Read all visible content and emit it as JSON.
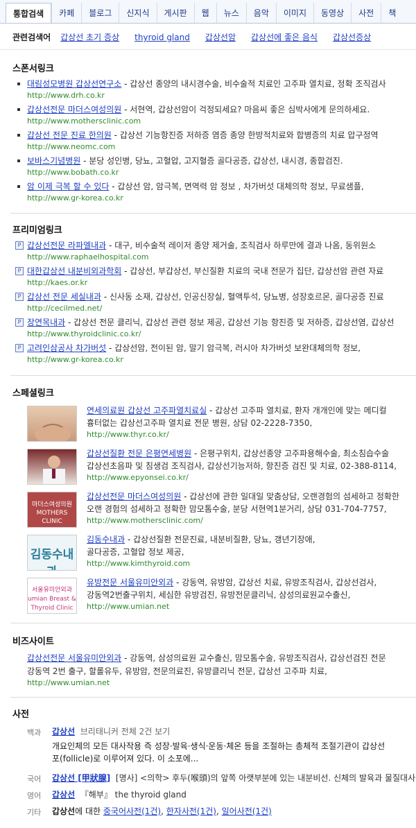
{
  "tabs": [
    "통합검색",
    "카페",
    "블로그",
    "신지식",
    "게시판",
    "웹",
    "뉴스",
    "음악",
    "이미지",
    "동영상",
    "사전",
    "책"
  ],
  "related": {
    "label": "관련검색어",
    "items": [
      "갑상선 초기 증상",
      "thyroid gland",
      "갑상선암",
      "갑상선에 좋은 음식",
      "갑상선증상"
    ]
  },
  "sponsor": {
    "title": "스폰서링크",
    "items": [
      {
        "title": "대림성모병원 갑상선연구소",
        "desc": "갑상선 종양의 내시경수술, 비수술적 치료인 고주파 열치료, 정확 조직검사",
        "url": "http://www.drh.co.kr"
      },
      {
        "title": "갑상선전문 마더스여성의원",
        "desc": "서현역, 갑상선암이 걱정되세요? 마음씨 좋은 심박사에게 문의하세요.",
        "url": "http://www.mothersclinic.com"
      },
      {
        "title": "갑상선 전문 진료 한의원",
        "desc": "갑상선 기능항진증 저하증 염증 종양 한방적치료와 합병증의 치료 압구정역",
        "url": "http://www.neomc.com"
      },
      {
        "title": "보바스기념병원",
        "desc": "분당 성인병, 당뇨, 고혈압, 고지혈증 골다공증, 갑상선, 내시경, 종합검진.",
        "url": "http://www.bobath.co.kr"
      },
      {
        "title": "암 이제 극복 할 수 있다",
        "desc": "갑상선 암, 암극복, 면역력 암 정보 , 차가버섯 대체의학 정보, 무료샘플,",
        "url": "http://www.gr-korea.co.kr"
      }
    ]
  },
  "premium": {
    "title": "프리미엄링크",
    "items": [
      {
        "title": "갑상선전문 라파엘내과",
        "desc": "대구, 비수술적 레이저 종양 제거술, 조직검사 하루만에 결과 나옴, 동위원소",
        "url": "http://www.raphaelhospital.com"
      },
      {
        "title": "대한갑상선 내분비외과학회",
        "desc": "갑상선, 부갑상선, 부신질환 치료의 국내 전문가 집단, 갑상선암 관련 자료",
        "url": "http://kaes.or.kr"
      },
      {
        "title": "갑상선 전문 세실내과",
        "desc": "신사동 소재, 갑상선, 인공신장실, 혈액투석, 당뇨병, 성장호르몬, 골다공증 진료",
        "url": "http://cecilmed.net/"
      },
      {
        "title": "장연목내과",
        "desc": "갑상선 전문 클리닉, 갑상선 관련 정보 제공, 갑상선 기능 항진증 및 저하증, 갑상선염, 갑상선",
        "url": "http://www.thyroidclinic.co.kr/"
      },
      {
        "title": "고려인삼공사 차가버섯",
        "desc": "갑상선암, 전이된 암, 말기 암극복, 러시아 차가버섯 보완대체의학 정보,",
        "url": "http://www.gr-korea.co.kr"
      }
    ]
  },
  "special": {
    "title": "스페셜링크",
    "items": [
      {
        "title": "연세의료원 갑상선 고주파열치료실",
        "desc": "갑상선 고주파 열치료, 환자 개개인에 맞는 메디컬",
        "desc2": "흉터없는 갑상선고주파 열치료 전문 병원, 상담 02-2228-7350,",
        "url": "http://www.thyr.co.kr/",
        "thumb_text": ""
      },
      {
        "title": "갑상선질환 전문 은평연세병원",
        "desc": "은평구위치, 갑상선종양 고주파용해수술, 최소침습수술",
        "desc2": "갑상선초음파 및 침생검 조직검사, 갑상선기능저하, 항진증 검진 및 치료, 02-388-8114,",
        "url": "http://www.epyonsei.co.kr/",
        "thumb_text": ""
      },
      {
        "title": "갑상선전문 마더스여성의원",
        "desc": "갑상선에 관한 일대일 맞춤상담, 오랜경험의 섬세하고 정확한",
        "desc2": "오랜 경험의 섬세하고 정확한 맘모톰수술, 분당 서현역1분거리, 상담 031-704-7757,",
        "url": "http://www.mothersclinic.com/",
        "thumb_text": "마더스여성의원 MOTHERS CLINIC"
      },
      {
        "title": "김동수내과",
        "desc": "갑상선질환 전문진료, 내분비질환, 당뇨, 갱년기장애,",
        "desc2": "골다공증, 고혈압 정보 제공,",
        "url": "http://www.kimthyroid.com",
        "thumb_text": "김동수내과"
      },
      {
        "title": "유방전문 서울유미안외과",
        "desc": "강동역, 유방암, 갑상선 치료, 유방조직검사, 갑상선검사,",
        "desc2": "강동역2번출구위치, 세심한 유방검진, 유방전문클리닉, 삼성의료원교수출신,",
        "url": "http://www.umian.net",
        "thumb_text": "서울유미안외과 umian Breast & Thyroid Clinic"
      }
    ]
  },
  "biz": {
    "title": "비즈사이트",
    "item": {
      "title": "갑상선전문 서울유미안외과",
      "desc": "강동역, 삼성의료원 교수출신, 맘모톰수술, 유방조직검사, 갑상선검진 전문",
      "desc2": "강동역 2번 출구, 할롤유두, 유방암, 전문의료진, 유방클리닉 전문, 갑상선 고주파 치료,",
      "url": "http://www.umian.net"
    }
  },
  "dict": {
    "title": "사전",
    "rows": [
      {
        "label": "백과",
        "word": "갑상선",
        "extra": "브리태니커   전체 2건 보기",
        "text1": "개요인체의 모든 대사작용 즉 성장·발육·생식·운동·체온 등을 조절하는 총체적 조절기관이 갑상선",
        "text2": "포(follicle)로 이루어져 있다. 이 소포에..."
      },
      {
        "label": "국어",
        "word": "갑상선 [甲狀腺]",
        "text": "[명사] <의학> 후두(喉頭)의 앞쪽 아랫부분에 있는 내분비선. 신체의 발육과 물질대사"
      },
      {
        "label": "영어",
        "word": "갑상선",
        "text": "『해부』 the thyroid gland"
      },
      {
        "label": "기타",
        "word": "갑상선",
        "prefix": "에 대한 ",
        "links": [
          "중국어사전(1건)",
          "한자사전(1건)",
          "일어사전(1건)"
        ]
      }
    ]
  }
}
